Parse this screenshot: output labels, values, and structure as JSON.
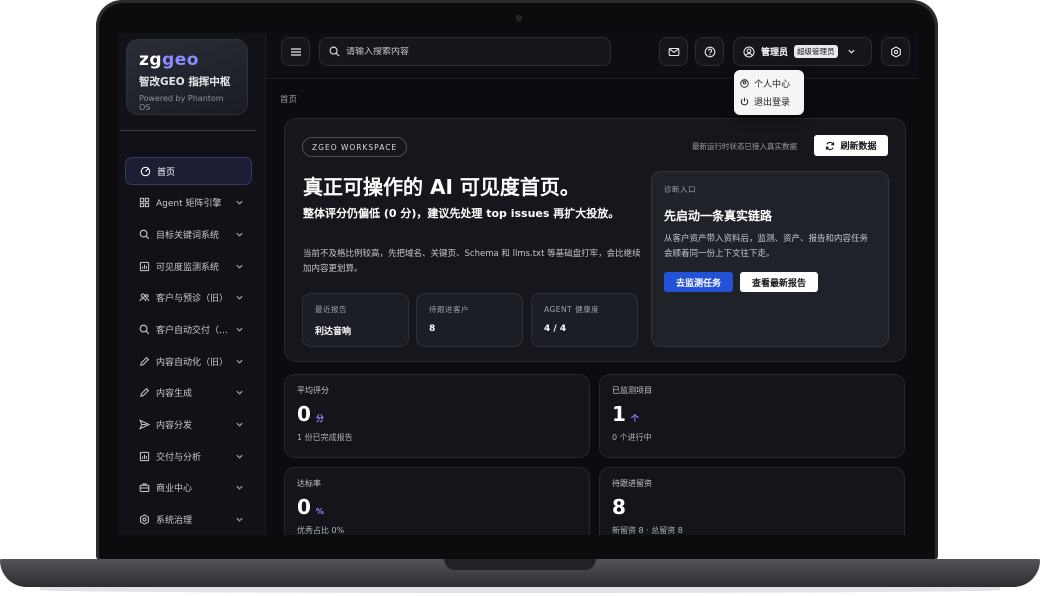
{
  "brand": {
    "logo_a": "zg",
    "logo_b": "geo",
    "name": "智改GEO 指挥中枢",
    "sub": "Powered by Phantom OS"
  },
  "sidebar": {
    "items": [
      {
        "label": "首页",
        "icon": "target-icon",
        "active": true,
        "chevron": false
      },
      {
        "label": "Agent 矩阵引擎",
        "icon": "grid-icon",
        "chevron": true
      },
      {
        "label": "目标关键词系统",
        "icon": "search-icon",
        "chevron": true
      },
      {
        "label": "可见度监测系统",
        "icon": "chart-icon",
        "chevron": true
      },
      {
        "label": "客户与预诊（旧）",
        "icon": "users-icon",
        "chevron": true
      },
      {
        "label": "客户自动交付（…",
        "icon": "search-icon",
        "chevron": true
      },
      {
        "label": "内容自动化（旧）",
        "icon": "pen-icon",
        "chevron": true
      },
      {
        "label": "内容生成",
        "icon": "pen-icon",
        "chevron": true
      },
      {
        "label": "内容分发",
        "icon": "send-icon",
        "chevron": true
      },
      {
        "label": "交付与分析",
        "icon": "chart-icon",
        "chevron": true
      },
      {
        "label": "商业中心",
        "icon": "briefcase-icon",
        "chevron": true
      },
      {
        "label": "系统治理",
        "icon": "gear-icon",
        "chevron": true
      }
    ]
  },
  "topbar": {
    "search_placeholder": "请输入搜索内容",
    "user_name": "管理员",
    "user_role": "超级管理员"
  },
  "dropdown": {
    "profile": "个人中心",
    "logout": "退出登录"
  },
  "breadcrumb": "首页",
  "hero": {
    "pill": "ZGEO WORKSPACE",
    "status": "最新运行时状态已接入真实数据",
    "refresh": "刷新数据",
    "title": "真正可操作的 AI 可见度首页。",
    "subtitle": "整体评分仍偏低 (0 分)，建议先处理 top issues 再扩大投放。",
    "desc": "当前不及格比例较高，先把域名、关键页、Schema 和 llms.txt 等基础盘打牢，会比继续加内容更划算。",
    "minis": [
      {
        "label": "最近报告",
        "value": "利达音响"
      },
      {
        "label": "待跟进客户",
        "value": "8"
      },
      {
        "label": "AGENT 健康度",
        "value": "4 / 4"
      }
    ],
    "diag": {
      "label": "诊断入口",
      "title": "先启动一条真实链路",
      "desc": "从客户资产带入资料后，监测、资产、报告和内容任务会顺着同一份上下文往下走。",
      "primary": "去监测任务",
      "secondary": "查看最新报告"
    }
  },
  "stats": [
    {
      "label": "平均评分",
      "value": "0",
      "unit": "分",
      "note": "1 份已完成报告"
    },
    {
      "label": "已监测项目",
      "value": "1",
      "unit": "个",
      "note": "0 个进行中"
    },
    {
      "label": "达标率",
      "value": "0",
      "unit": "%",
      "note": "优秀占比 0%"
    },
    {
      "label": "待跟进留资",
      "value": "8",
      "unit": "",
      "note": "新留资 8 · 总留资 8"
    }
  ]
}
